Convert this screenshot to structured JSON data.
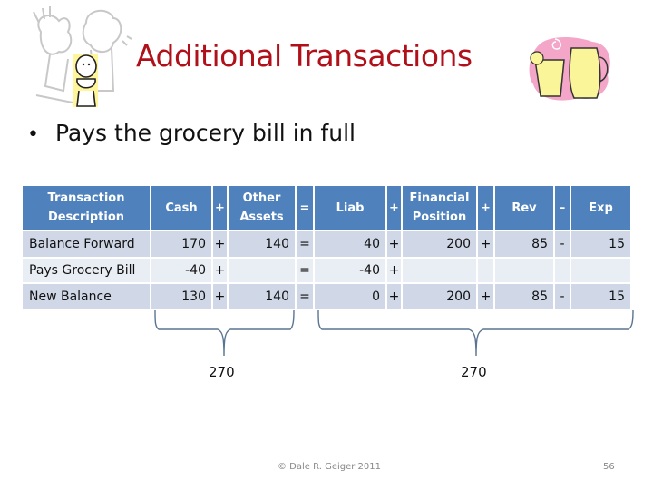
{
  "slide": {
    "title": "Additional Transactions",
    "bullet": "Pays the grocery bill in full",
    "footer_copyright": "© Dale R. Geiger 2011",
    "page_number": "56",
    "colors": {
      "title": "#B0101A",
      "header_bg": "#4F81BD",
      "row_band_dark": "#D0D8E8",
      "row_band_light": "#E9EDF4"
    },
    "clipart": {
      "left": "people-cartoon-icon",
      "right": "lemonade-pitcher-icon"
    }
  },
  "table": {
    "headers": {
      "desc": "Transaction Description",
      "cash": "Cash",
      "op1": "+",
      "other": "Other Assets",
      "op2": "=",
      "liab": "Liab",
      "op3": "+",
      "fin": "Financial Position",
      "op4": "+",
      "rev": "Rev",
      "op5": "–",
      "exp": "Exp"
    },
    "rows": [
      {
        "desc": "Balance Forward",
        "cash": "170",
        "op1": "+",
        "other": "140",
        "op2": "=",
        "liab": "40",
        "op3": "+",
        "fin": "200",
        "op4": "+",
        "rev": "85",
        "op5": "-",
        "exp": "15"
      },
      {
        "desc": "Pays Grocery Bill",
        "cash": "-40",
        "op1": "+",
        "other": "",
        "op2": "=",
        "liab": "-40",
        "op3": "+",
        "fin": "",
        "op4": "",
        "rev": "",
        "op5": "",
        "exp": ""
      },
      {
        "desc": "New Balance",
        "cash": "130",
        "op1": "+",
        "other": "140",
        "op2": "=",
        "liab": "0",
        "op3": "+",
        "fin": "200",
        "op4": "+",
        "rev": "85",
        "op5": "-",
        "exp": "15"
      }
    ]
  },
  "totals": {
    "assets_total": "270",
    "claims_total": "270"
  }
}
